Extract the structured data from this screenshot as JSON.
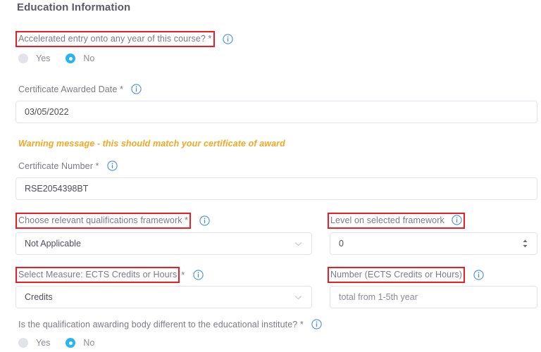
{
  "section": {
    "title": "Education Information"
  },
  "accelerated": {
    "label": "Accelerated entry onto any year of this course? *",
    "info_icon": "info-circle-icon",
    "options": [
      {
        "label": "Yes",
        "selected": false
      },
      {
        "label": "No",
        "selected": true
      }
    ]
  },
  "certificate_date": {
    "label": "Certificate Awarded Date *",
    "info_icon": "info-circle-icon",
    "value": "03/05/2022"
  },
  "warning": {
    "text": "Warning message - this should match your certificate of award"
  },
  "certificate_number": {
    "label": "Certificate Number *",
    "info_icon": "info-circle-icon",
    "value": "RSE2054398BT"
  },
  "framework": {
    "label": "Choose relevant qualifications framework *",
    "info_icon": "info-circle-icon",
    "value": "Not Applicable",
    "chevron_icon": "chevron-down-icon"
  },
  "level": {
    "label": "Level on selected framework",
    "info_icon": "info-circle-icon",
    "value": "0",
    "spinner_icon": "number-spinner-icon"
  },
  "measure": {
    "label_boxed": "Select Measure: ECTS Credits or Hours",
    "label_suffix": "*",
    "info_icon": "info-circle-icon",
    "value": "Credits",
    "chevron_icon": "chevron-down-icon"
  },
  "number": {
    "label": "Number (ECTS Credits or Hours)",
    "info_icon": "info-circle-icon",
    "placeholder": "total from 1-5th year"
  },
  "awarding_body": {
    "label": "Is the qualification awarding body different to the educational institute? *",
    "info_icon": "info-circle-icon",
    "options": [
      {
        "label": "Yes",
        "selected": false
      },
      {
        "label": "No",
        "selected": true
      }
    ]
  },
  "colors": {
    "highlight": "#ee1c25",
    "accent": "#29b6f0",
    "warning": "#f5a623",
    "label": "#7b7b86",
    "border": "#e3e4ea"
  }
}
